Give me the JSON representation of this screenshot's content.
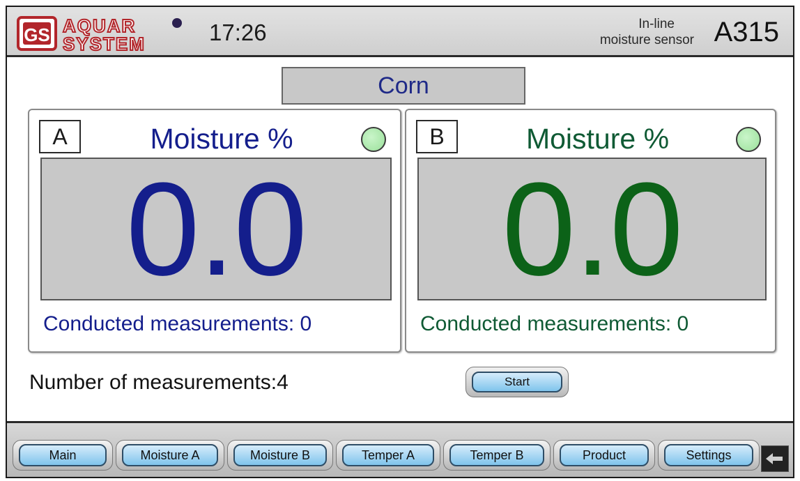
{
  "header": {
    "brand_line1": "AQUAR",
    "brand_line2": "SYSTEM",
    "time": "17:26",
    "subtitle_line1": "In-line",
    "subtitle_line2": "moisture sensor",
    "model": "A315"
  },
  "product": "Corn",
  "channels": [
    {
      "letter": "A",
      "title": "Moisture %",
      "value": "0.0",
      "counter_label": "Conducted measurements:",
      "counter_value": "0",
      "color": "#141e8c",
      "led_color": "#9be09b"
    },
    {
      "letter": "B",
      "title": "Moisture %",
      "value": "0.0",
      "counter_label": "Conducted measurements:",
      "counter_value": "0",
      "color": "#0c6218",
      "led_color": "#9be09b"
    }
  ],
  "measurements": {
    "label": "Number of measurements:",
    "value": "4"
  },
  "start_label": "Start",
  "nav": {
    "items": [
      {
        "label": "Main"
      },
      {
        "label": "Moisture A"
      },
      {
        "label": "Moisture B"
      },
      {
        "label": "Temper A"
      },
      {
        "label": "Temper B"
      },
      {
        "label": "Product"
      },
      {
        "label": "Settings"
      }
    ],
    "back_icon": "back-arrow-icon"
  },
  "colors": {
    "button_fill": "#7fc4ec",
    "display_bg": "#c8c8c8",
    "title_blue": "#1f2a88"
  }
}
